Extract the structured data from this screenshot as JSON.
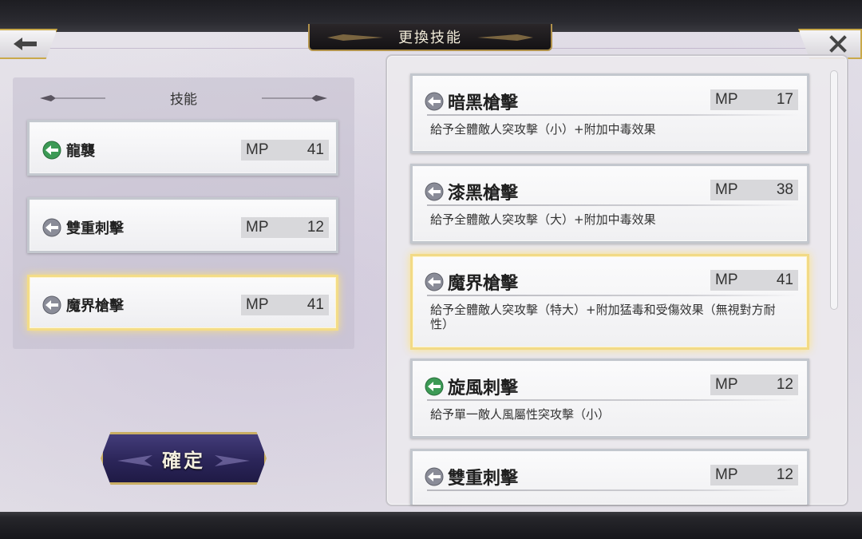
{
  "header": {
    "title": "更換技能"
  },
  "left_panel": {
    "heading": "技能",
    "slots": [
      {
        "name": "龍襲",
        "mp_label": "MP",
        "mp": "41",
        "icon": "green-arrow-orb-icon",
        "selected": false
      },
      {
        "name": "雙重刺擊",
        "mp_label": "MP",
        "mp": "12",
        "icon": "grey-arrow-orb-icon",
        "selected": false
      },
      {
        "name": "魔界槍擊",
        "mp_label": "MP",
        "mp": "41",
        "icon": "grey-arrow-orb-icon",
        "selected": true
      }
    ],
    "confirm_label": "確定"
  },
  "skill_list": [
    {
      "name": "暗黑槍擊",
      "mp_label": "MP",
      "mp": "17",
      "icon": "grey-arrow-orb-icon",
      "desc": "給予全體敵人突攻擊（小）+附加中毒效果",
      "selected": false
    },
    {
      "name": "漆黑槍擊",
      "mp_label": "MP",
      "mp": "38",
      "icon": "grey-arrow-orb-icon",
      "desc": "給予全體敵人突攻擊（大）+附加中毒效果",
      "selected": false
    },
    {
      "name": "魔界槍擊",
      "mp_label": "MP",
      "mp": "41",
      "icon": "grey-arrow-orb-icon",
      "desc": "給予全體敵人突攻擊（特大）+附加猛毒和受傷效果（無視對方耐性）",
      "selected": true
    },
    {
      "name": "旋風刺擊",
      "mp_label": "MP",
      "mp": "12",
      "icon": "green-arrow-orb-icon",
      "desc": "給予單一敵人風屬性突攻擊（小）",
      "selected": false
    },
    {
      "name": "雙重刺擊",
      "mp_label": "MP",
      "mp": "12",
      "icon": "grey-arrow-orb-icon",
      "desc": "",
      "selected": false
    }
  ],
  "colors": {
    "accent_gold": "#f2da86",
    "confirm_bg": "#2b2559",
    "green_orb": "#3c9a55",
    "grey_orb": "#8a8c98"
  }
}
